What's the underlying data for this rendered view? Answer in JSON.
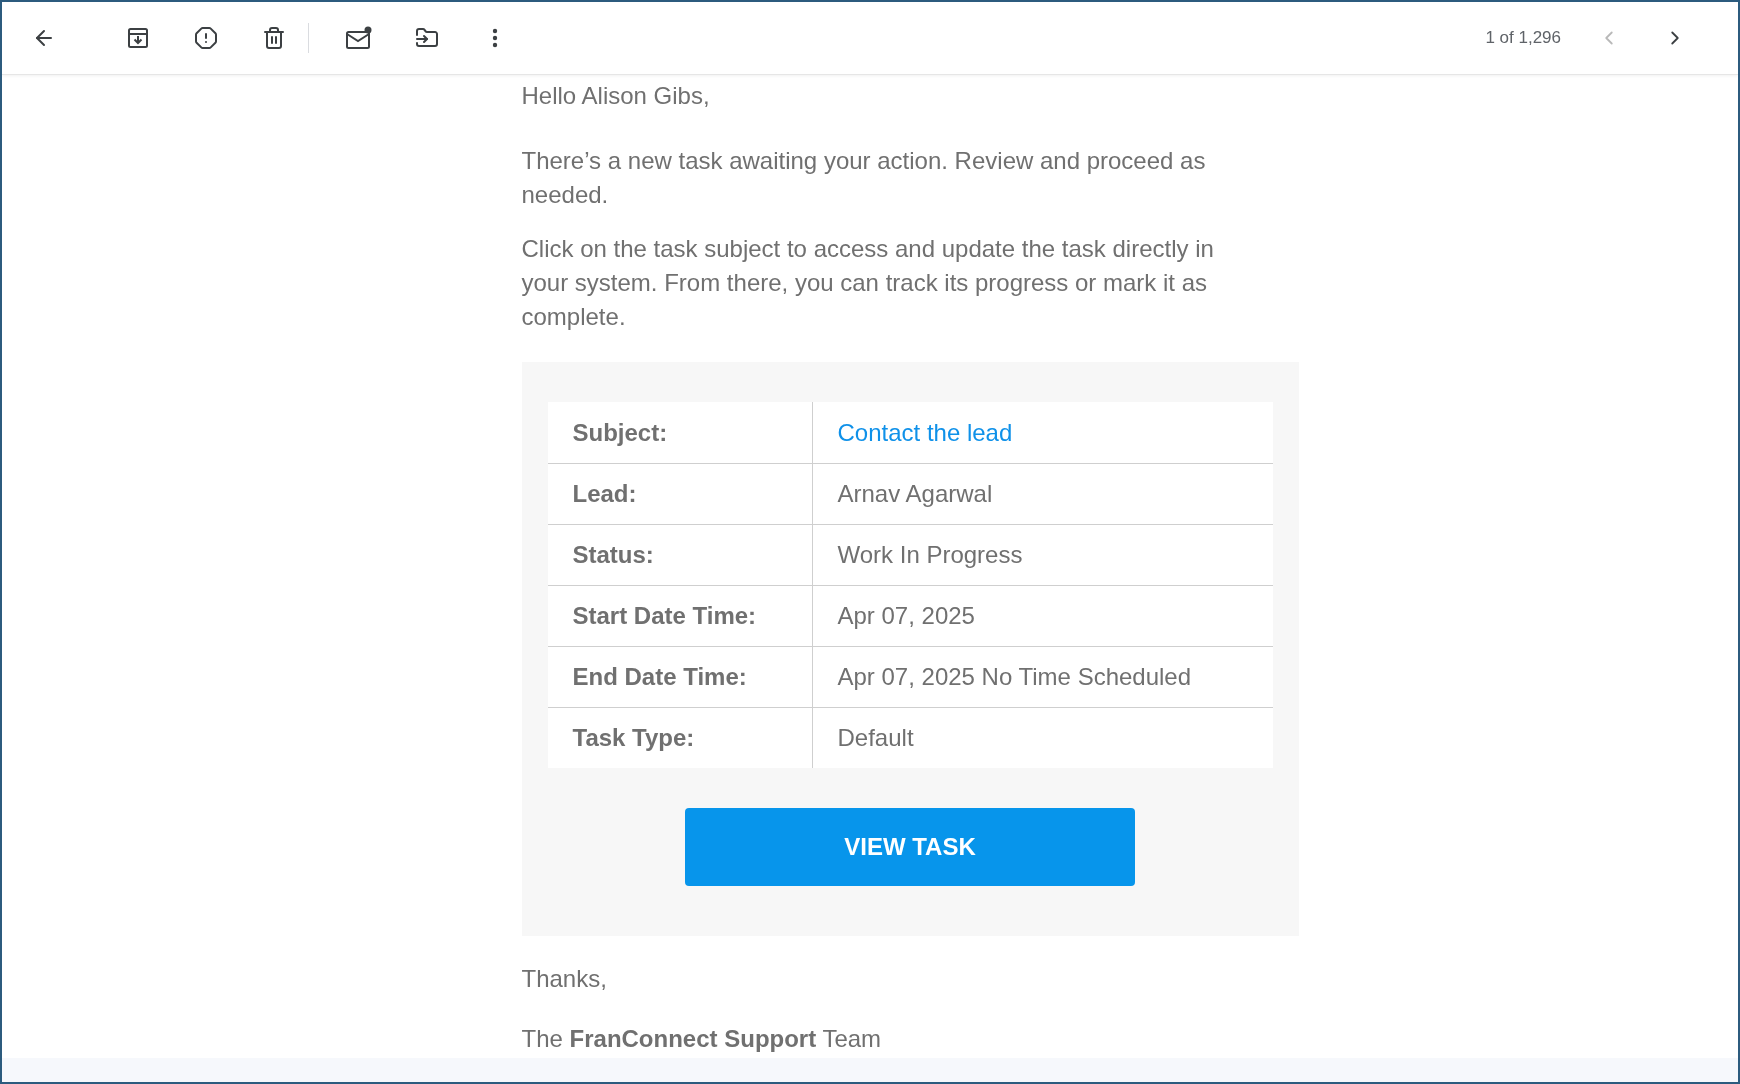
{
  "toolbar": {
    "pager": "1 of 1,296",
    "previous": {
      "disabled": true
    },
    "next": {
      "disabled": false
    }
  },
  "email": {
    "greeting": "Hello Alison Gibs,",
    "paragraphs": [
      "There’s a new task awaiting your action. Review and proceed as needed.",
      "Click on the task subject to access and update the task directly in your system. From there, you can track its progress or mark it as complete."
    ],
    "task_table": [
      {
        "label": "Subject:",
        "value": "Contact the lead",
        "kind": "link"
      },
      {
        "label": "Lead:",
        "value": "Arnav Agarwal",
        "kind": "text"
      },
      {
        "label": "Status:",
        "value": "Work In Progress",
        "kind": "text"
      },
      {
        "label": "Start Date Time:",
        "value": "Apr 07, 2025",
        "kind": "text"
      },
      {
        "label": "End Date Time:",
        "value": "Apr 07, 2025 No Time Scheduled",
        "kind": "text"
      },
      {
        "label": "Task Type:",
        "value": "Default",
        "kind": "text"
      }
    ],
    "button": "VIEW TASK",
    "closing": [
      "Thanks,",
      "The **FranConnect Support** Team"
    ]
  }
}
